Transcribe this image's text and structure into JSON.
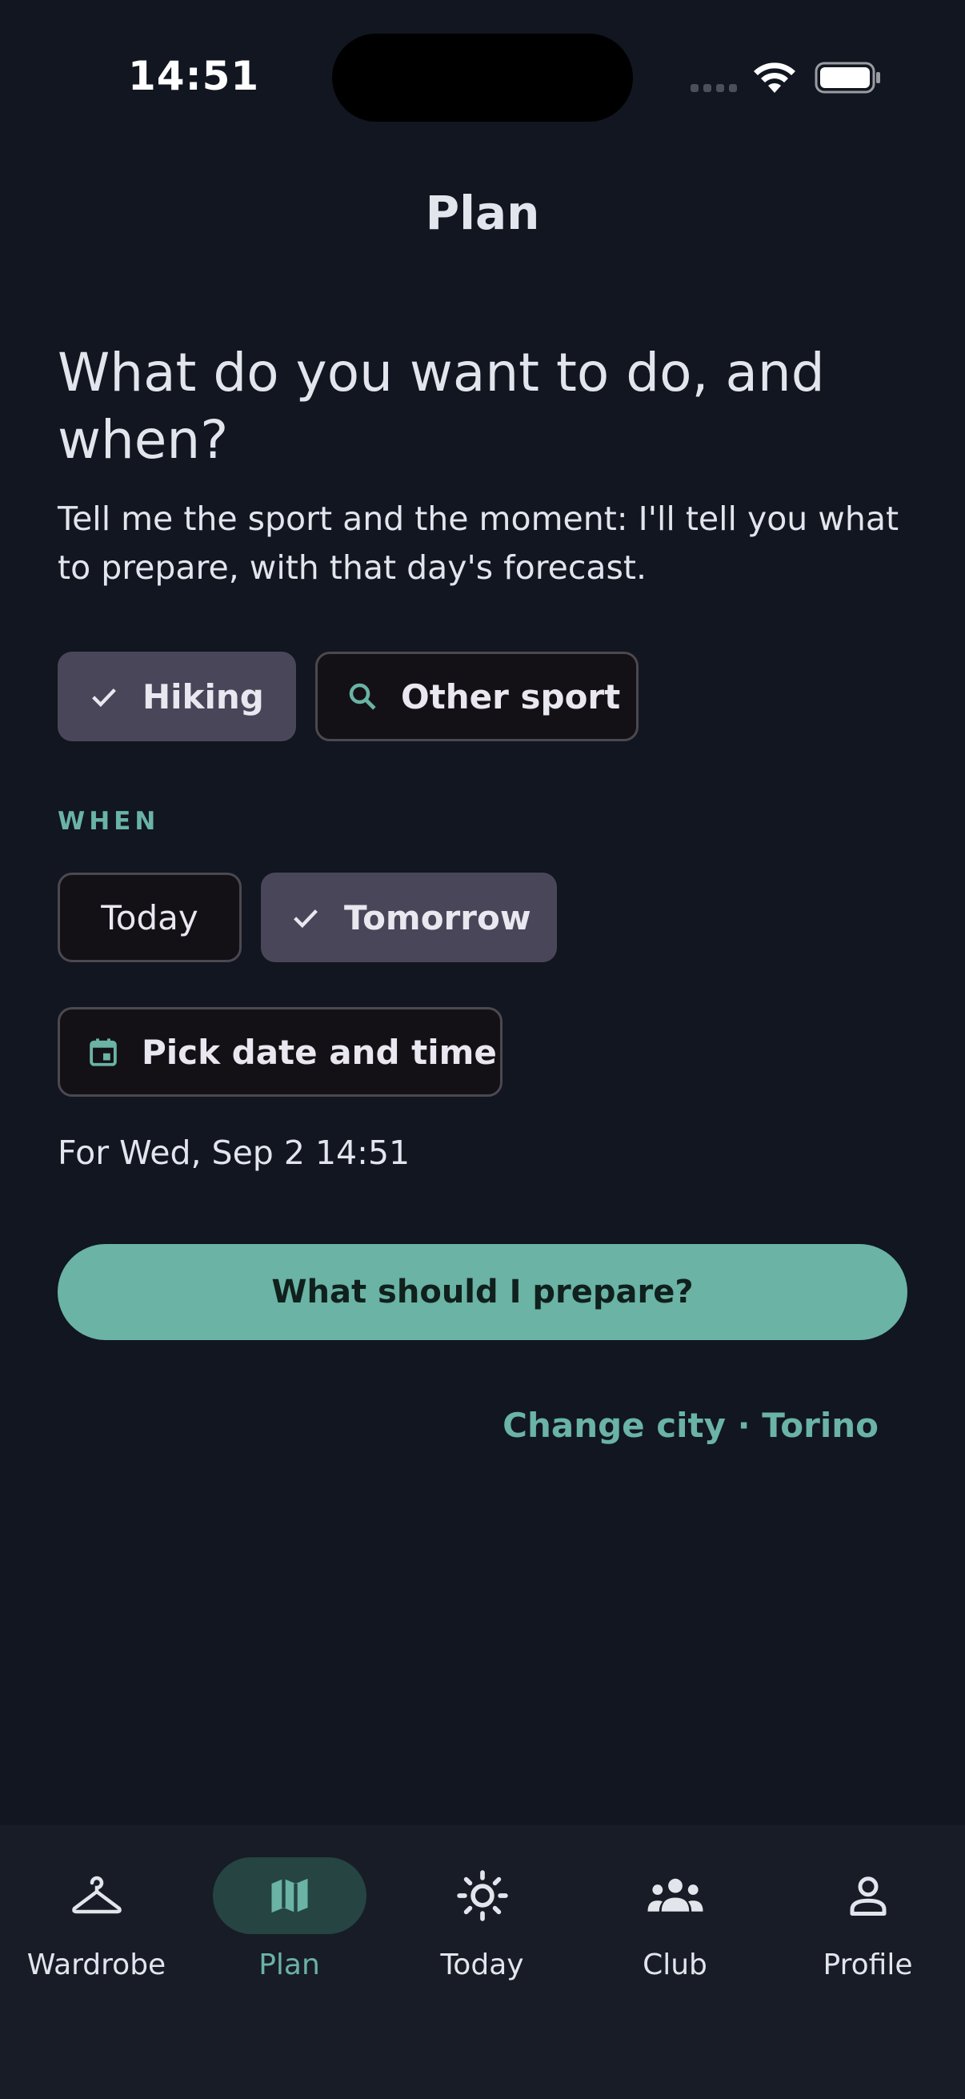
{
  "status_bar": {
    "time": "14:51"
  },
  "header": {
    "title": "Plan"
  },
  "prompt": {
    "headline": "What do you want to do, and when?",
    "subtitle": "Tell me the sport and the moment: I'll tell you what to prepare, with that day's forecast."
  },
  "sport_chips": [
    {
      "label": "Hiking",
      "selected": true,
      "icon": "check-icon"
    },
    {
      "label": "Other sport",
      "selected": false,
      "icon": "search-icon"
    }
  ],
  "when": {
    "section_label": "WHEN",
    "chips": [
      {
        "label": "Today",
        "selected": false
      },
      {
        "label": "Tomorrow",
        "selected": true,
        "icon": "check-icon"
      }
    ],
    "pick_button": {
      "label": "Pick date and time",
      "icon": "calendar-icon"
    },
    "selected_text": "For Wed, Sep 2 14:51"
  },
  "cta": {
    "label": "What should I prepare?"
  },
  "location": {
    "change_label": "Change city · Torino"
  },
  "colors": {
    "accent": "#6ab3a5",
    "background": "#111620",
    "chip_selected": "#4a4659",
    "nav_background": "#181c26"
  },
  "bottom_nav": {
    "items": [
      {
        "label": "Wardrobe",
        "icon": "hanger-icon",
        "active": false
      },
      {
        "label": "Plan",
        "icon": "map-icon",
        "active": true
      },
      {
        "label": "Today",
        "icon": "sun-icon",
        "active": false
      },
      {
        "label": "Club",
        "icon": "group-icon",
        "active": false
      },
      {
        "label": "Profile",
        "icon": "person-icon",
        "active": false
      }
    ]
  }
}
